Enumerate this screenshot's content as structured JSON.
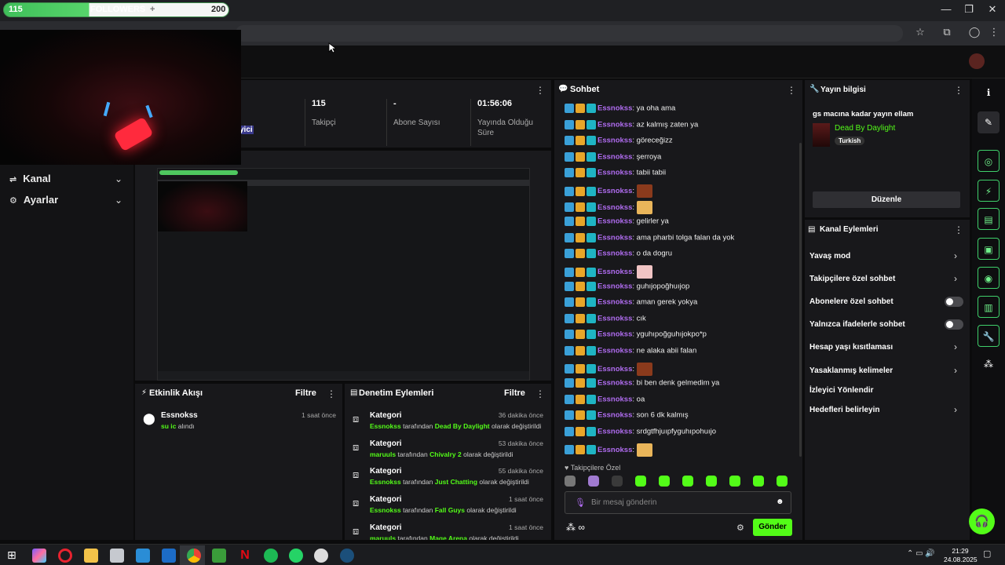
{
  "follower_goal": {
    "current": "115",
    "label": "FOLLOWERS",
    "plus": "+",
    "target": "200"
  },
  "window": {
    "minimize": "—",
    "restore": "❐",
    "close": "✕"
  },
  "browser": {
    "star": "☆",
    "ext": "⧉",
    "profile": "◯",
    "menu": "⋮"
  },
  "sidebar": {
    "items": [
      {
        "label": "Kanal"
      },
      {
        "label": "Ayarlar"
      }
    ]
  },
  "stats": {
    "partial_label": "yici",
    "items": [
      {
        "value": "115",
        "label": "Takipçi"
      },
      {
        "value": "-",
        "label": "Abone Sayısı"
      },
      {
        "value": "01:56:06",
        "label": "Yayında Olduğu Süre"
      }
    ]
  },
  "activity": {
    "title": "Etkinlik Akışı",
    "filter": "Filtre",
    "items": [
      {
        "user": "Essnokss",
        "gift": "su ic",
        "action": "alındı",
        "time": "1 saat önce"
      }
    ]
  },
  "moderation": {
    "title": "Denetim Eylemleri",
    "filter": "Filtre",
    "items": [
      {
        "title": "Kategori",
        "time": "36 dakika önce",
        "user": "Essnokss",
        "by": "tarafından",
        "value": "Dead By Daylight",
        "suffix": "olarak değiştirildi"
      },
      {
        "title": "Kategori",
        "time": "53 dakika önce",
        "user": "maruuls",
        "by": "tarafından",
        "value": "Chivalry 2",
        "suffix": "olarak değiştirildi"
      },
      {
        "title": "Kategori",
        "time": "55 dakika önce",
        "user": "Essnokss",
        "by": "tarafından",
        "value": "Just Chatting",
        "suffix": "olarak değiştirildi"
      },
      {
        "title": "Kategori",
        "time": "1 saat önce",
        "user": "Essnokss",
        "by": "tarafından",
        "value": "Fall Guys",
        "suffix": "olarak değiştirildi"
      },
      {
        "title": "Kategori",
        "time": "1 saat önce",
        "user": "maruuls",
        "by": "tarafından",
        "value": "Mage Arena",
        "suffix": "olarak değiştirildi"
      }
    ]
  },
  "chat": {
    "title": "Sohbet",
    "messages": [
      {
        "user": "Essnokss",
        "text": "ya oha ama",
        "emote": ""
      },
      {
        "user": "Essnokss",
        "text": "az kalmış zaten ya",
        "emote": ""
      },
      {
        "user": "Essnokss",
        "text": "göreceğizz",
        "emote": ""
      },
      {
        "user": "Essnokss",
        "text": "şerroya",
        "emote": ""
      },
      {
        "user": "Essnokss",
        "text": "tabii tabii",
        "emote": ""
      },
      {
        "user": "Essnokss",
        "text": "",
        "emote": "#8a3a1c"
      },
      {
        "user": "Essnokss",
        "text": "",
        "emote": "#e9b55a"
      },
      {
        "user": "Essnokss",
        "text": "gelirler ya",
        "emote": ""
      },
      {
        "user": "Essnokss",
        "text": "ama pharbi tolga falan da yok",
        "emote": ""
      },
      {
        "user": "Essnokss",
        "text": "o da dogru",
        "emote": ""
      },
      {
        "user": "Essnokss",
        "text": "",
        "emote": "#f0c4c4"
      },
      {
        "user": "Essnokss",
        "text": "guhıjopoğhuıjop",
        "emote": ""
      },
      {
        "user": "Essnokss",
        "text": "aman gerek yokya",
        "emote": ""
      },
      {
        "user": "Essnokss",
        "text": "cık",
        "emote": ""
      },
      {
        "user": "Essnokss",
        "text": "yguhıpoğguhıjokpo*p",
        "emote": ""
      },
      {
        "user": "Essnokss",
        "text": "ne alaka abii falan",
        "emote": ""
      },
      {
        "user": "Essnokss",
        "text": "",
        "emote": "#8a3a1c"
      },
      {
        "user": "Essnokss",
        "text": "bi ben denk gelmedim ya",
        "emote": ""
      },
      {
        "user": "Essnokss",
        "text": "oa",
        "emote": ""
      },
      {
        "user": "Essnokss",
        "text": "son 6 dk kalmış",
        "emote": ""
      },
      {
        "user": "Essnokss",
        "text": "srdgtfhjuıpfyguhıpohuıjo",
        "emote": ""
      },
      {
        "user": "Essnokss",
        "text": "",
        "emote": "#e9b55a"
      }
    ],
    "followers_only": "Takipçilere Özel",
    "input_placeholder": "Bir mesaj gönderin",
    "send": "Gönder"
  },
  "stream_info": {
    "title": "Yayın bilgisi",
    "stream_title": "gs macına kadar yayın ellam",
    "category": "Dead By Daylight",
    "language": "Turkish",
    "edit": "Düzenle"
  },
  "channel_actions": {
    "title": "Kanal Eylemleri",
    "items": [
      {
        "label": "Yavaş mod",
        "kind": "chevron"
      },
      {
        "label": "Takipçilere özel sohbet",
        "kind": "chevron"
      },
      {
        "label": "Abonelere özel sohbet",
        "kind": "toggle"
      },
      {
        "label": "Yalnızca ifadelerle sohbet",
        "kind": "toggle"
      },
      {
        "label": "Hesap yaşı kısıtlaması",
        "kind": "chevron"
      },
      {
        "label": "Yasaklanmış kelimeler",
        "kind": "chevron"
      },
      {
        "label": "İzleyici Yönlendir",
        "kind": "none"
      },
      {
        "label": "Hedefleri belirleyin",
        "kind": "chevron"
      }
    ]
  },
  "taskbar": {
    "time": "21:29",
    "date": "24.08.2025"
  },
  "colors": {
    "accent_green": "#53fc18",
    "username_purple": "#b06cf0",
    "panel": "#18181b"
  }
}
